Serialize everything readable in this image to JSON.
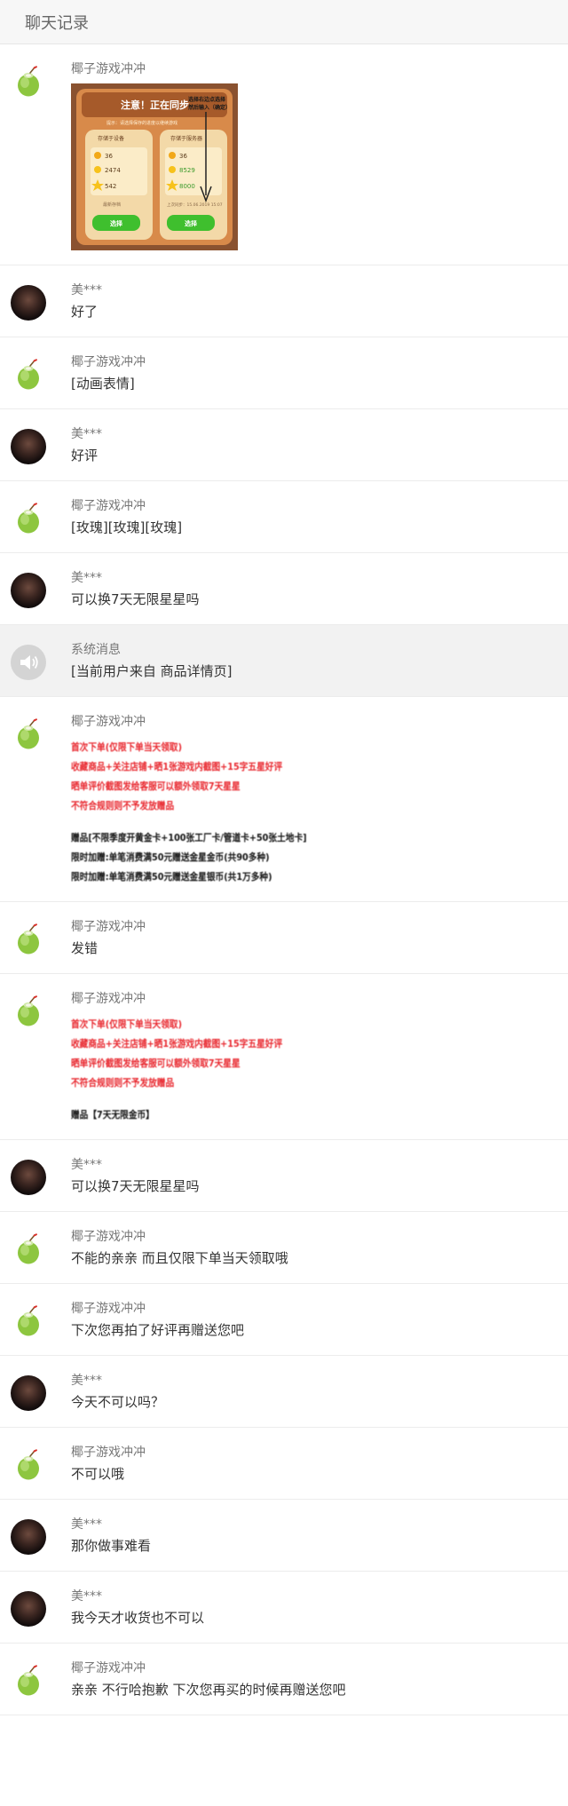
{
  "header": {
    "title": "聊天记录"
  },
  "game_card": {
    "banner": "注意！正在同步",
    "note_top": "选择右边点选择",
    "note_top2": "然后输入（确定）",
    "subtitle": "提示：请选择保存的进度以继续游戏",
    "left_title": "存储于设备",
    "right_title": "存储于服务器",
    "left_values": [
      "36",
      "2474",
      "542"
    ],
    "right_values": [
      "36",
      "8529",
      "8000"
    ],
    "left_footer": "最新存档",
    "right_footer": "上次同步：15.06.2019 15:07",
    "button_left": "选择",
    "button_right": "选择"
  },
  "messages": [
    {
      "sender": "椰子游戏冲冲",
      "avatar": "coconut",
      "type": "image"
    },
    {
      "sender": "美***",
      "avatar": "person",
      "text": "好了"
    },
    {
      "sender": "椰子游戏冲冲",
      "avatar": "coconut",
      "text": "[动画表情]"
    },
    {
      "sender": "美***",
      "avatar": "person",
      "text": "好评"
    },
    {
      "sender": "椰子游戏冲冲",
      "avatar": "coconut",
      "text": "[玫瑰][玫瑰][玫瑰]"
    },
    {
      "sender": "美***",
      "avatar": "person",
      "text": "可以换7天无限星星吗"
    },
    {
      "sender": "系统消息",
      "avatar": "speaker",
      "text": "[当前用户来自 商品详情页]"
    },
    {
      "sender": "椰子游戏冲冲",
      "avatar": "coconut",
      "type": "promo",
      "red_lines": [
        "首次下单(仅限下单当天领取)",
        "收藏商品+关注店铺+晒1张游戏内截图+15字五星好评",
        "晒单评价截图发给客服可以额外领取7天星星",
        "不符合规则则不予发放赠品"
      ],
      "black_lines": [
        "赠品[不限季度开黄金卡+100张工厂卡/管道卡+50张土地卡]",
        "限时加赠:单笔消费满50元赠送金星金币(共90多种)",
        "限时加赠:单笔消费满50元赠送金星银币(共1万多种)"
      ]
    },
    {
      "sender": "椰子游戏冲冲",
      "avatar": "coconut",
      "text": "发错"
    },
    {
      "sender": "椰子游戏冲冲",
      "avatar": "coconut",
      "type": "promo",
      "red_lines": [
        "首次下单(仅限下单当天领取)",
        "收藏商品+关注店铺+晒1张游戏内截图+15字五星好评",
        "晒单评价截图发给客服可以额外领取7天星星",
        "不符合规则则不予发放赠品"
      ],
      "black_lines": [
        "赠品【7天无限金币】"
      ]
    },
    {
      "sender": "美***",
      "avatar": "person",
      "text": "可以换7天无限星星吗"
    },
    {
      "sender": "椰子游戏冲冲",
      "avatar": "coconut",
      "text": "不能的亲亲 而且仅限下单当天领取哦"
    },
    {
      "sender": "椰子游戏冲冲",
      "avatar": "coconut",
      "text": "下次您再拍了好评再赠送您吧"
    },
    {
      "sender": "美***",
      "avatar": "person",
      "text": "今天不可以吗？"
    },
    {
      "sender": "椰子游戏冲冲",
      "avatar": "coconut",
      "text": "不可以哦"
    },
    {
      "sender": "美***",
      "avatar": "person",
      "text": "那你做事难看"
    },
    {
      "sender": "美***",
      "avatar": "person",
      "text": "我今天才收货也不可以"
    },
    {
      "sender": "椰子游戏冲冲",
      "avatar": "coconut",
      "text": "亲亲 不行哈抱歉 下次您再买的时候再赠送您吧"
    }
  ]
}
